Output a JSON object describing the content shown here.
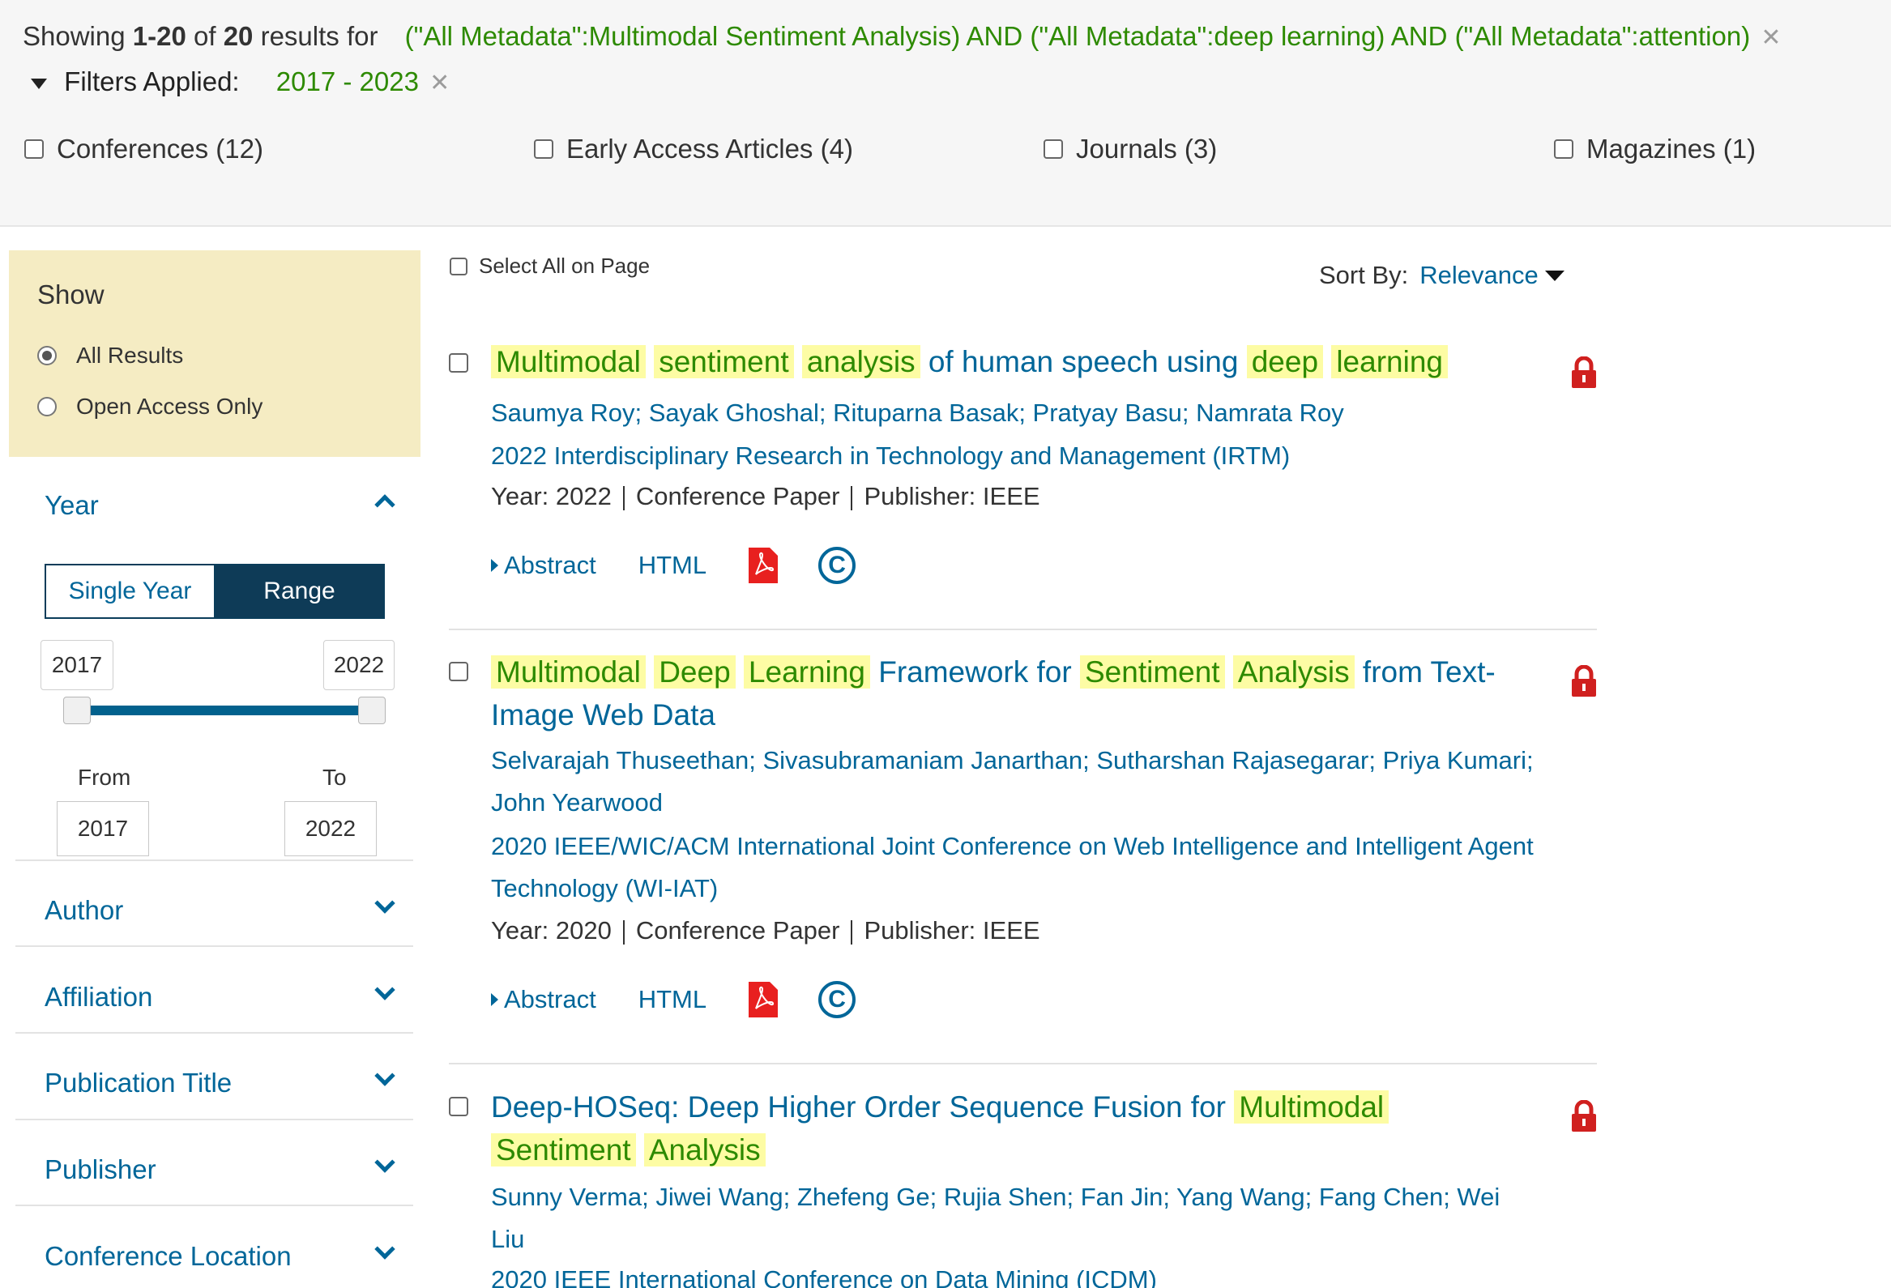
{
  "summary": {
    "showing_prefix": "Showing",
    "range": "1-20",
    "of": "of",
    "total": "20",
    "results_for": "results for",
    "query": "(\"All Metadata\":Multimodal Sentiment Analysis) AND (\"All Metadata\":deep learning) AND (\"All Metadata\":attention)",
    "filters_label": "Filters Applied:",
    "filter_value": "2017 - 2023"
  },
  "content_types": [
    {
      "label": "Conferences (12)"
    },
    {
      "label": "Early Access Articles (4)"
    },
    {
      "label": "Journals (3)"
    },
    {
      "label": "Magazines (1)"
    }
  ],
  "sidebar": {
    "show_title": "Show",
    "show_options": [
      {
        "label": "All Results",
        "selected": true
      },
      {
        "label": "Open Access Only",
        "selected": false
      }
    ],
    "year": {
      "title": "Year",
      "single_label": "Single Year",
      "range_label": "Range",
      "range_min": "2017",
      "range_max": "2022",
      "from_label": "From",
      "to_label": "To",
      "from_value": "2017",
      "to_value": "2022"
    },
    "facets": [
      "Author",
      "Affiliation",
      "Publication Title",
      "Publisher",
      "Conference Location"
    ]
  },
  "results_header": {
    "select_all": "Select All on Page",
    "sort_label": "Sort By:",
    "sort_value": "Relevance"
  },
  "results": [
    {
      "title_parts": [
        {
          "t": "Multimodal",
          "hl": true
        },
        {
          "t": " ",
          "hl": false
        },
        {
          "t": "sentiment",
          "hl": true
        },
        {
          "t": " ",
          "hl": false
        },
        {
          "t": "analysis",
          "hl": true
        },
        {
          "t": " of human speech using ",
          "hl": false
        },
        {
          "t": "deep",
          "hl": true
        },
        {
          "t": " ",
          "hl": false
        },
        {
          "t": "learning",
          "hl": true
        }
      ],
      "authors": "Saumya Roy; Sayak Ghoshal; Rituparna Basak; Pratyay Basu; Namrata Roy",
      "venue": "2022 Interdisciplinary Research in Technology and Management (IRTM)",
      "year": "Year: 2022",
      "type": "Conference Paper",
      "publisher": "Publisher:  IEEE",
      "abstract": "Abstract",
      "html": "HTML"
    },
    {
      "title_parts": [
        {
          "t": "Multimodal",
          "hl": true
        },
        {
          "t": " ",
          "hl": false
        },
        {
          "t": "Deep",
          "hl": true
        },
        {
          "t": " ",
          "hl": false
        },
        {
          "t": "Learning",
          "hl": true
        },
        {
          "t": " Framework for ",
          "hl": false
        },
        {
          "t": "Sentiment",
          "hl": true
        },
        {
          "t": " ",
          "hl": false
        },
        {
          "t": "Analysis",
          "hl": true
        },
        {
          "t": " from Text-Image Web Data",
          "hl": false
        }
      ],
      "authors": "Selvarajah Thuseethan; Sivasubramaniam Janarthan; Sutharshan Rajasegarar; Priya Kumari; John Yearwood",
      "venue": "2020 IEEE/WIC/ACM International Joint Conference on Web Intelligence and Intelligent Agent Technology (WI-IAT)",
      "year": "Year: 2020",
      "type": "Conference Paper",
      "publisher": "Publisher:  IEEE",
      "abstract": "Abstract",
      "html": "HTML"
    },
    {
      "title_parts": [
        {
          "t": "Deep-HOSeq: Deep Higher Order Sequence Fusion for ",
          "hl": false
        },
        {
          "t": "Multimodal",
          "hl": true
        },
        {
          "t": " ",
          "hl": false
        },
        {
          "t": "Sentiment",
          "hl": true
        },
        {
          "t": " ",
          "hl": false
        },
        {
          "t": "Analysis",
          "hl": true
        }
      ],
      "authors": "Sunny Verma; Jiwei Wang; Zhefeng Ge; Rujia Shen; Fan Jin; Yang Wang; Fang Chen; Wei Liu",
      "venue": "2020 IEEE International Conference on Data Mining (ICDM)"
    }
  ],
  "colors": {
    "link": "#006699",
    "highlight_bg": "#fdfca4",
    "highlight_text": "#2d8a00",
    "show_panel": "#f5ecc3",
    "range_active": "#0e3b57",
    "lock": "#d0201f",
    "pdf": "#e8201f"
  }
}
